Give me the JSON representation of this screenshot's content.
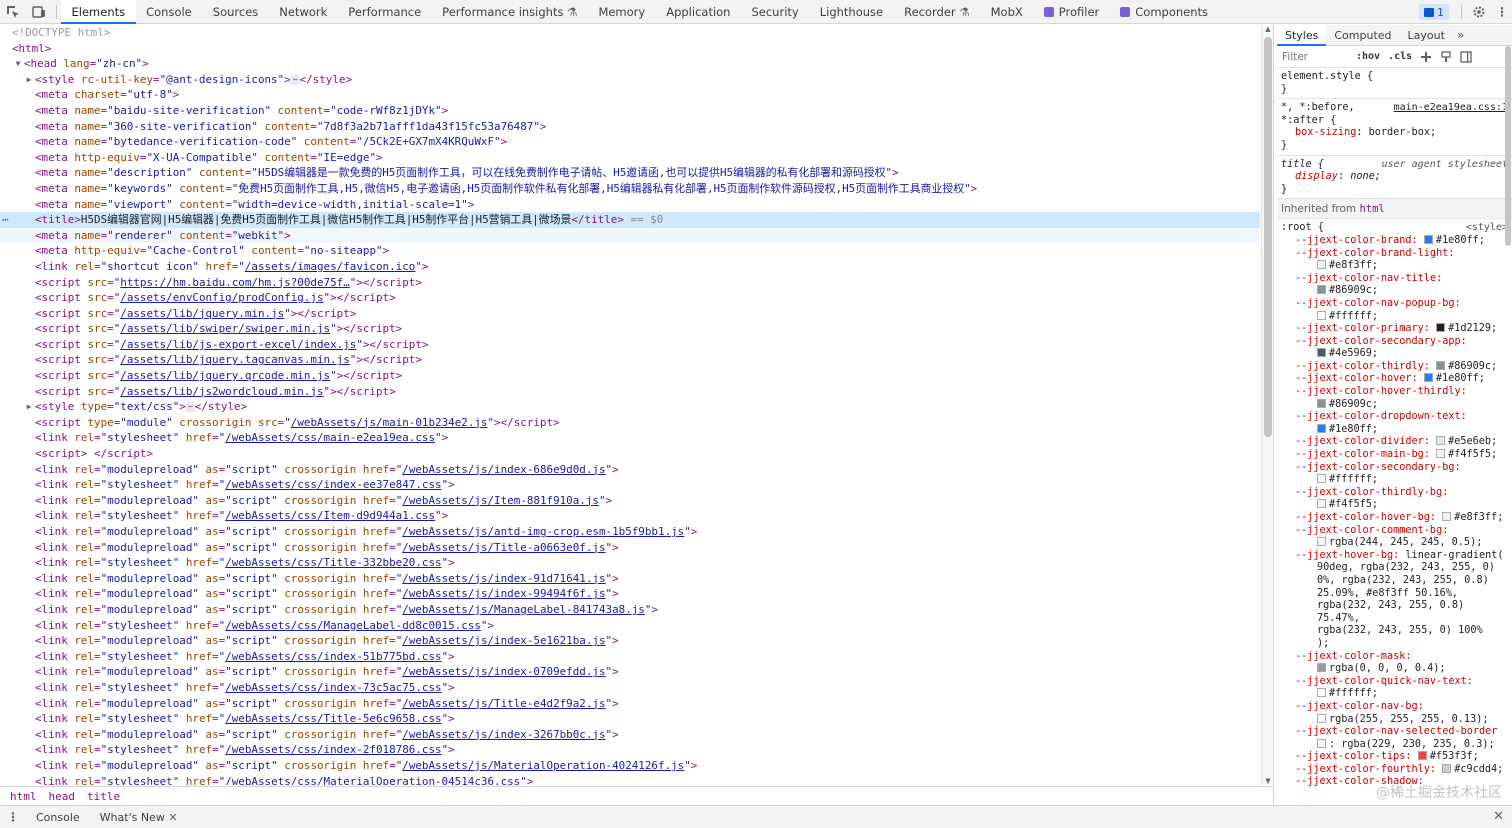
{
  "toolbar": {
    "tabs": [
      "Elements",
      "Console",
      "Sources",
      "Network",
      "Performance",
      "Performance insights",
      "Memory",
      "Application",
      "Security",
      "Lighthouse",
      "Recorder",
      "MobX",
      "Profiler",
      "Components"
    ],
    "issues_count": "1"
  },
  "tree": {
    "l0": "<!DOCTYPE html>",
    "html_open": "<html>",
    "head": {
      "tag": "<head",
      "attr": "lang",
      "val": "\"zh-cn\"",
      "close": ">"
    },
    "style1": {
      "attr": "rc-util-key",
      "val": "\"@ant-design-icons\""
    },
    "meta_charset": "\"utf-8\"",
    "meta1": {
      "name": "\"baidu-site-verification\"",
      "content": "\"code-rWf8z1jDYk\""
    },
    "meta2": {
      "name": "\"360-site-verification\"",
      "content": "\"7d8f3a2b71afff1da43f15fc53a76487\""
    },
    "meta3": {
      "name": "\"bytedance-verification-code\"",
      "content": "\"/5Ck2E+GX7mX4KRQuWxF\""
    },
    "meta4": {
      "equiv": "\"X-UA-Compatible\"",
      "content": "\"IE=edge\""
    },
    "meta5": {
      "name": "\"description\"",
      "content": "\"H5DS编辑器是一款免费的H5页面制作工具，可以在线免费制作电子请帖、H5邀请函,也可以提供H5编辑器的私有化部署和源码授权\""
    },
    "meta6": {
      "name": "\"keywords\"",
      "content": "\"免费H5页面制作工具,H5,微信H5,电子邀请函,H5页面制作软件私有化部署,H5编辑器私有化部署,H5页面制作软件源码授权,H5页面制作工具商业授权\""
    },
    "meta7": {
      "name": "\"viewport\"",
      "content": "\"width=device-width,initial-scale=1\""
    },
    "title_text": "H5DS编辑器官网|H5编辑器|免费H5页面制作工具|微信H5制作工具|H5制作平台|H5营销工具|微场景",
    "selected_marker": "== $0",
    "meta8": {
      "name": "\"renderer\"",
      "content": "\"webkit\""
    },
    "meta9": {
      "equiv": "\"Cache-Control\"",
      "content": "\"no-siteapp\""
    },
    "favicon": "/assets/images/favicon.ico",
    "scripts": [
      "https://hm.baidu.com/hm.js?00de75f…",
      "/assets/envConfig/prodConfig.js",
      "/assets/lib/jquery.min.js",
      "/assets/lib/swiper/swiper.min.js",
      "/assets/lib/js-export-excel/index.js",
      "/assets/lib/jquery.tagcanvas.min.js",
      "/assets/lib/jquery.qrcode.min.js",
      "/assets/lib/js2wordcloud.min.js"
    ],
    "style_css": "\"text/css\"",
    "main_js": "/webAssets/js/main-01b234e2.js",
    "main_css": "/webAssets/css/main-e2ea19ea.css",
    "links": [
      {
        "rel": "modulepreload",
        "href": "/webAssets/js/index-686e9d0d.js"
      },
      {
        "rel": "stylesheet",
        "href": "/webAssets/css/index-ee37e847.css"
      },
      {
        "rel": "modulepreload",
        "href": "/webAssets/js/Item-881f910a.js"
      },
      {
        "rel": "stylesheet",
        "href": "/webAssets/css/Item-d9d944a1.css"
      },
      {
        "rel": "modulepreload",
        "href": "/webAssets/js/antd-img-crop.esm-1b5f9bb1.js"
      },
      {
        "rel": "modulepreload",
        "href": "/webAssets/js/Title-a0663e0f.js"
      },
      {
        "rel": "stylesheet",
        "href": "/webAssets/css/Title-332bbe20.css"
      },
      {
        "rel": "modulepreload",
        "href": "/webAssets/js/index-91d71641.js"
      },
      {
        "rel": "modulepreload",
        "href": "/webAssets/js/index-99494f6f.js"
      },
      {
        "rel": "modulepreload",
        "href": "/webAssets/js/ManageLabel-841743a8.js"
      },
      {
        "rel": "stylesheet",
        "href": "/webAssets/css/ManageLabel-dd8c0015.css"
      },
      {
        "rel": "modulepreload",
        "href": "/webAssets/js/index-5e1621ba.js"
      },
      {
        "rel": "stylesheet",
        "href": "/webAssets/css/index-51b775bd.css"
      },
      {
        "rel": "modulepreload",
        "href": "/webAssets/js/index-0709efdd.js"
      },
      {
        "rel": "stylesheet",
        "href": "/webAssets/css/index-73c5ac75.css"
      },
      {
        "rel": "modulepreload",
        "href": "/webAssets/js/Title-e4d2f9a2.js"
      },
      {
        "rel": "stylesheet",
        "href": "/webAssets/css/Title-5e6c9658.css"
      },
      {
        "rel": "modulepreload",
        "href": "/webAssets/js/index-3267bb0c.js"
      },
      {
        "rel": "stylesheet",
        "href": "/webAssets/css/index-2f018786.css"
      },
      {
        "rel": "modulepreload",
        "href": "/webAssets/js/MaterialOperation-4024126f.js"
      },
      {
        "rel": "stylesheet",
        "href": "/webAssets/css/MaterialOperation-04514c36.css"
      }
    ]
  },
  "breadcrumb": [
    "html",
    "head",
    "title"
  ],
  "styles": {
    "tabs": [
      "Styles",
      "Computed",
      "Layout"
    ],
    "filter_placeholder": "Filter",
    "hov": ":hov",
    "cls": ".cls",
    "element_style": "element.style {",
    "close_brace": "}",
    "rule1_selector_a": "*, *:before,",
    "rule1_selector_b": "*:after {",
    "rule1_source": "main-e2ea19ea.css:1",
    "rule1_prop": "box-sizing",
    "rule1_val": "border-box;",
    "rule2_selector": "title {",
    "rule2_source": "user agent stylesheet",
    "rule2_prop": "display",
    "rule2_val": "none;",
    "inherited_label": "Inherited from",
    "inherited_tag": "html",
    "root_selector": ":root {",
    "root_source": "<style>",
    "vars": [
      {
        "n": "--jjext-color-brand:",
        "v": "#1e80ff;",
        "c": "#1e80ff",
        "wrap": false
      },
      {
        "n": "--jjext-color-brand-light:",
        "v": "#e8f3ff;",
        "c": "#e8f3ff",
        "wrap": true
      },
      {
        "n": "--jjext-color-nav-title:",
        "v": "#86909c;",
        "c": "#86909c",
        "wrap": true
      },
      {
        "n": "--jjext-color-nav-popup-bg:",
        "v": "#ffffff;",
        "c": "#ffffff",
        "wrap": true
      },
      {
        "n": "--jjext-color-primary:",
        "v": "#1d2129;",
        "c": "#1d2129",
        "wrap": false
      },
      {
        "n": "--jjext-color-secondary-app:",
        "v": "#4e5969;",
        "c": "#4e5969",
        "wrap": true
      },
      {
        "n": "--jjext-color-thirdly:",
        "v": "#86909c;",
        "c": "#86909c",
        "wrap": false
      },
      {
        "n": "--jjext-color-hover:",
        "v": "#1e80ff;",
        "c": "#1e80ff",
        "wrap": false
      },
      {
        "n": "--jjext-color-hover-thirdly:",
        "v": "#86909c;",
        "c": "#86909c",
        "wrap": true
      },
      {
        "n": "--jjext-color-dropdown-text:",
        "v": "#1e80ff;",
        "c": "#1e80ff",
        "wrap": true
      },
      {
        "n": "--jjext-color-divider:",
        "v": "#e5e6eb;",
        "c": "#e5e6eb",
        "wrap": false
      },
      {
        "n": "--jjext-color-main-bg:",
        "v": "#f4f5f5;",
        "c": "#f4f5f5",
        "wrap": false
      },
      {
        "n": "--jjext-color-secondary-bg:",
        "v": "#ffffff;",
        "c": "#ffffff",
        "wrap": true
      },
      {
        "n": "--jjext-color-thirdly-bg:",
        "v": "#f4f5f5;",
        "c": "#f4f5f5",
        "wrap": true
      },
      {
        "n": "--jjext-color-hover-bg:",
        "v": "#e8f3ff;",
        "c": "#e8f3ff",
        "wrap": false
      },
      {
        "n": "--jjext-color-comment-bg:",
        "v": "rgba(244, 245, 245, 0.5);",
        "c": "rgba(244,245,245,0.5)",
        "wrap": true
      }
    ],
    "hover_bg_name": "--jjext-hover-bg:",
    "hover_bg_lines": [
      "linear-gradient(",
      "90deg, rgba(232, 243, 255, 0)",
      "0%, rgba(232, 243, 255, 0.8)",
      "25.09%, #e8f3ff 50.16%,",
      "rgba(232, 243, 255, 0.8)",
      "75.47%,",
      "rgba(232, 243, 255, 0) 100%",
      ");"
    ],
    "vars2": [
      {
        "n": "--jjext-color-mask:",
        "v": "rgba(0, 0, 0, 0.4);",
        "c": "rgba(0,0,0,0.4)",
        "wrap": true
      },
      {
        "n": "--jjext-color-quick-nav-text:",
        "v": "#ffffff;",
        "c": "#ffffff",
        "wrap": true
      },
      {
        "n": "--jjext-color-nav-bg:",
        "v": "rgba(255, 255, 255, 0.13);",
        "c": "rgba(255,255,255,0.13)",
        "wrap": true
      },
      {
        "n": "--jjext-color-nav-selected-border",
        "v": ": rgba(229, 230, 235, 0.3);",
        "c": "rgba(229,230,235,0.3)",
        "wrap": true
      },
      {
        "n": "--jjext-color-tips:",
        "v": "#f53f3f;",
        "c": "#f53f3f",
        "wrap": false
      },
      {
        "n": "--jjext-color-fourthly:",
        "v": "#c9cdd4;",
        "c": "#c9cdd4",
        "wrap": false
      },
      {
        "n": "--jjext-color-shadow:",
        "v": "",
        "c": "",
        "wrap": false
      }
    ],
    "watermark": "@稀土掘金技术社区"
  },
  "drawer": {
    "tabs": [
      "Console",
      "What's New"
    ]
  }
}
